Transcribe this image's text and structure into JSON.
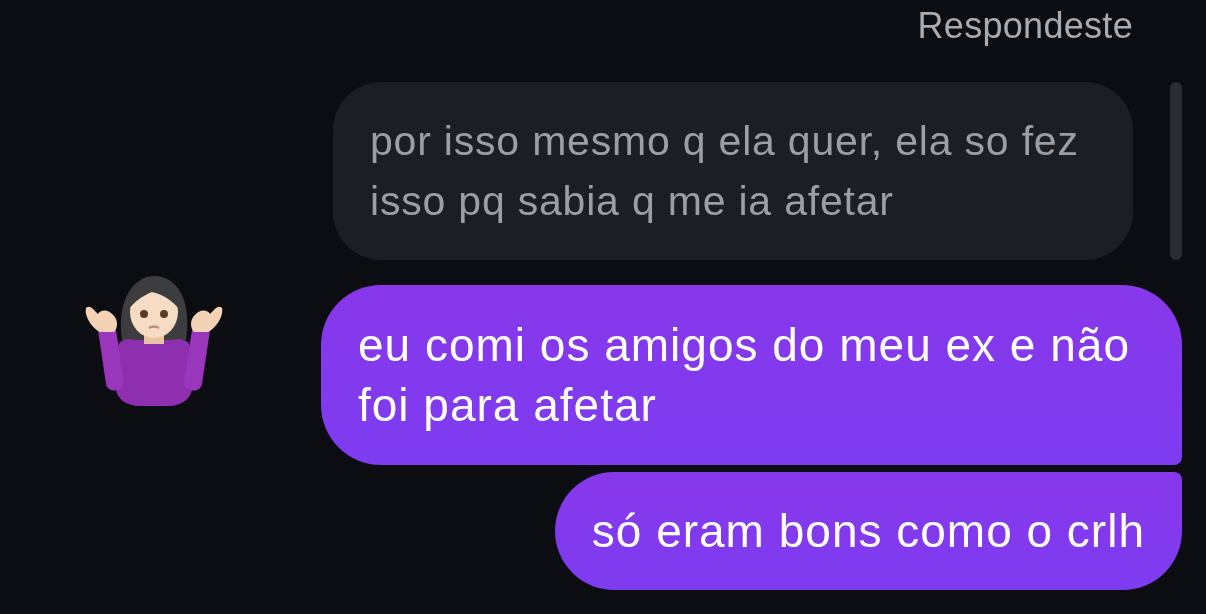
{
  "reply_label": "Respondeste",
  "replied_message": {
    "text": "por isso mesmo q ela quer, ela so fez isso pq sabia q me ia afetar"
  },
  "messages": [
    {
      "text": "eu comi os amigos do meu ex e não foi para afetar"
    },
    {
      "text": "só eram bons como o crlh"
    }
  ]
}
